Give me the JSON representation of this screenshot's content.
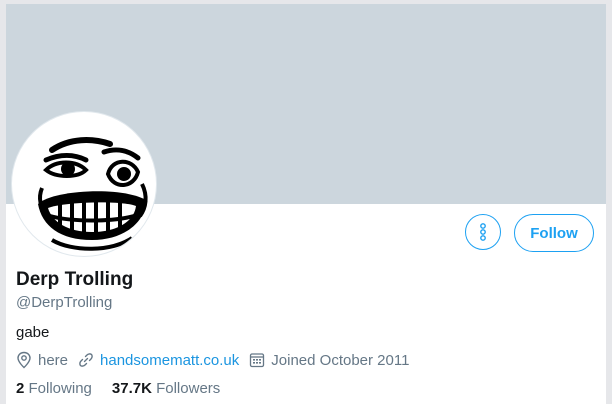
{
  "profile": {
    "display_name": "Derp Trolling",
    "handle": "@DerpTrolling",
    "bio": "gabe",
    "location": "here",
    "website": "handsomematt.co.uk",
    "joined": "Joined October 2011"
  },
  "actions": {
    "more_icon": "more-vertical-icon",
    "follow_label": "Follow"
  },
  "stats": {
    "following_count": "2",
    "following_label": "Following",
    "followers_count": "37.7K",
    "followers_label": "Followers"
  },
  "icons": {
    "location": "location-pin-icon",
    "website": "link-icon",
    "joined": "calendar-icon"
  },
  "colors": {
    "banner": "#ccd6dd",
    "accent": "#1da1f2",
    "link": "#1b95e0",
    "secondary_text": "#657786",
    "primary_text": "#14171a"
  }
}
